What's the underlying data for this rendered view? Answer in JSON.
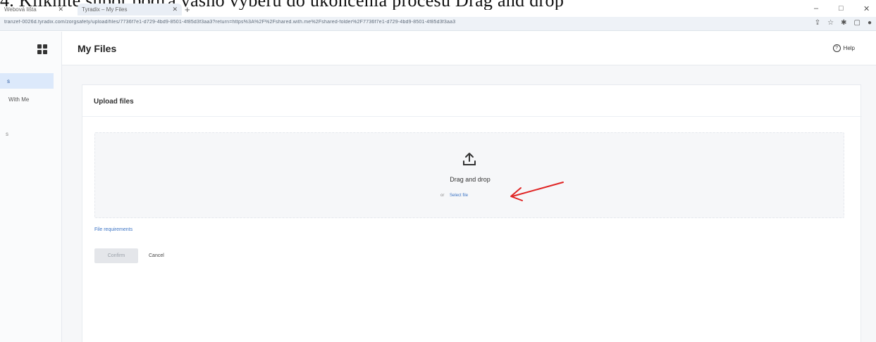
{
  "caption": "4. Kliknite súbor podľa vášho výberu do ukončenia procesu Drag and drop",
  "browser": {
    "tabs": [
      {
        "label": "Webová lišta"
      },
      {
        "label": "Tyradix – My Files"
      }
    ],
    "url": "tranzef-0026d.tyradix.com/zorgsafety/upload/files/7736f7e1-d729-4bd9-8501-4f85d3f3aa3?return=https%3A%2F%2Fshared.with.me%2Fshared-folder%2F7736f7e1-d729-4bd9-8501-4f85d3f3aa3",
    "window_controls": [
      "–",
      "□",
      "✕"
    ]
  },
  "sidebar": {
    "items": [
      {
        "label": "s"
      },
      {
        "label": "With Me"
      },
      {
        "label": "s"
      }
    ]
  },
  "header": {
    "title": "My Files",
    "help_label": "Help"
  },
  "upload": {
    "title": "Upload files",
    "dropzone_title": "Drag and drop",
    "or_label": "or",
    "select_file_label": "Select file",
    "requirements_link": "File requirements",
    "confirm_label": "Confirm",
    "cancel_label": "Cancel"
  },
  "colors": {
    "accent": "#3b73c4",
    "annotation_arrow": "#e02424",
    "sidebar_active": "#dce9fb"
  }
}
